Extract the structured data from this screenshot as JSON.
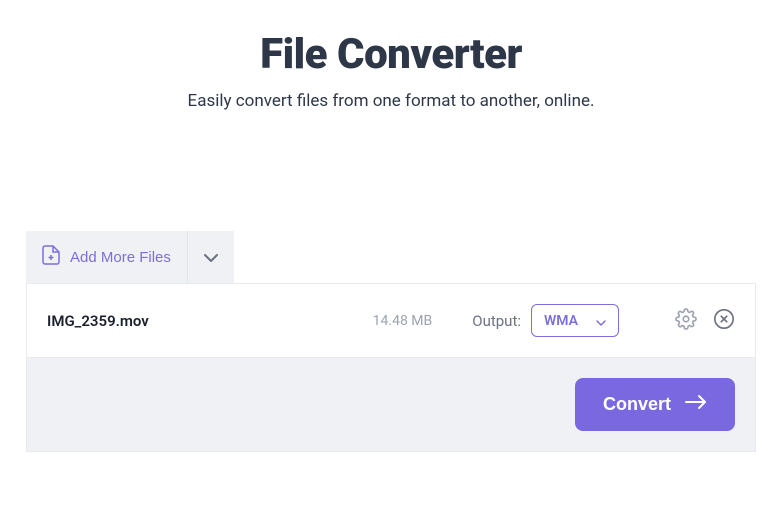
{
  "header": {
    "title": "File Converter",
    "subtitle": "Easily convert files from one format to another, online."
  },
  "toolbar": {
    "add_more_label": "Add More Files"
  },
  "files": [
    {
      "name": "IMG_2359.mov",
      "size": "14.48 MB",
      "output_label": "Output:",
      "format": "WMA"
    }
  ],
  "actions": {
    "convert_label": "Convert"
  },
  "colors": {
    "accent": "#7968e0",
    "accent_light": "#7c6fdb",
    "text_dark": "#2d3748",
    "muted": "#9ca3af",
    "panel_bg": "#f0f1f5"
  }
}
